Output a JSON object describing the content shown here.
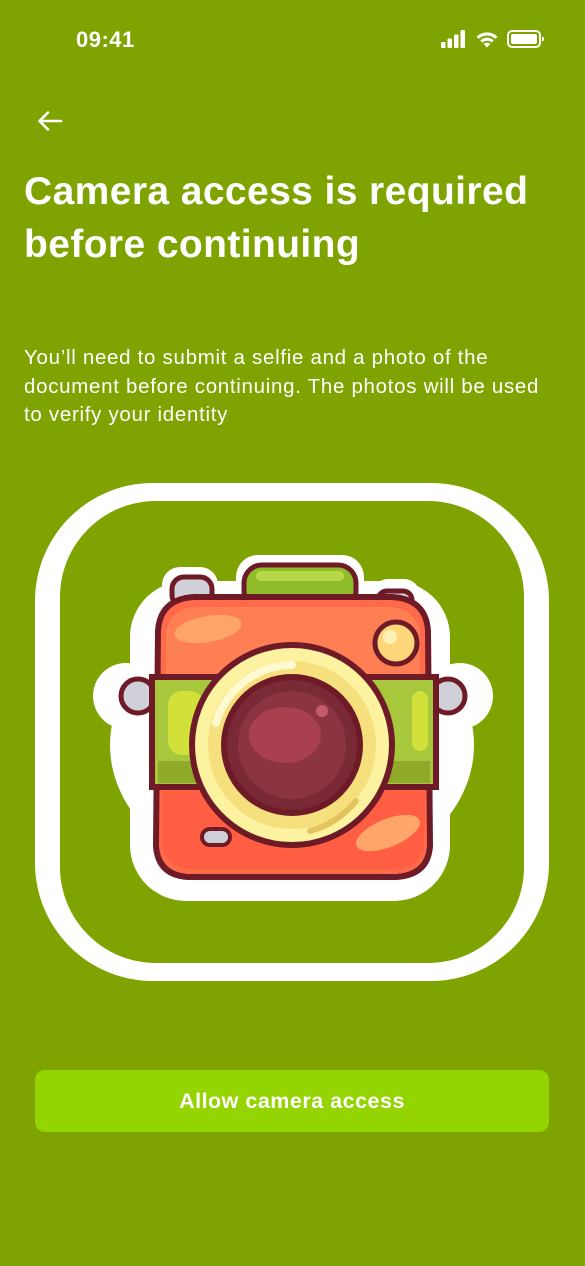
{
  "status_bar": {
    "time": "09:41",
    "icons": [
      "signal-icon",
      "wifi-icon",
      "battery-icon"
    ]
  },
  "nav": {
    "back_icon": "arrow-left-icon"
  },
  "content": {
    "title": "Camera access is required before continuing",
    "subtitle": "You’ll need to submit a selfie and a photo of the document before continuing. The photos will be used to verify your identity"
  },
  "illustration": {
    "icon": "camera-icon"
  },
  "cta": {
    "label": "Allow camera access"
  },
  "colors": {
    "background": "#7fa300",
    "button": "#94d400",
    "text": "#ffffff"
  }
}
